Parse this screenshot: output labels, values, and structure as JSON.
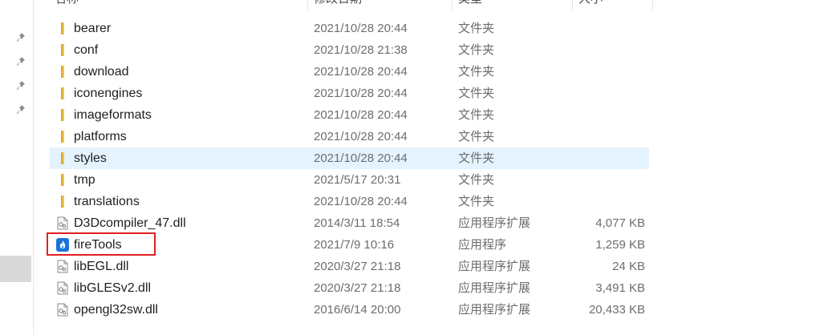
{
  "columns": {
    "name": "名称",
    "date": "修改日期",
    "type": "类型",
    "size": "大小"
  },
  "colors": {
    "folder": "#f5c344",
    "accent": "#e02020",
    "hover": "#e5f3ff"
  },
  "rows": [
    {
      "name": "bearer",
      "date": "2021/10/28 20:44",
      "type": "文件夹",
      "size": "",
      "icon": "folder-icon"
    },
    {
      "name": "conf",
      "date": "2021/10/28 21:38",
      "type": "文件夹",
      "size": "",
      "icon": "folder-icon"
    },
    {
      "name": "download",
      "date": "2021/10/28 20:44",
      "type": "文件夹",
      "size": "",
      "icon": "folder-icon"
    },
    {
      "name": "iconengines",
      "date": "2021/10/28 20:44",
      "type": "文件夹",
      "size": "",
      "icon": "folder-icon"
    },
    {
      "name": "imageformats",
      "date": "2021/10/28 20:44",
      "type": "文件夹",
      "size": "",
      "icon": "folder-icon"
    },
    {
      "name": "platforms",
      "date": "2021/10/28 20:44",
      "type": "文件夹",
      "size": "",
      "icon": "folder-icon"
    },
    {
      "name": "styles",
      "date": "2021/10/28 20:44",
      "type": "文件夹",
      "size": "",
      "icon": "folder-icon"
    },
    {
      "name": "tmp",
      "date": "2021/5/17 20:31",
      "type": "文件夹",
      "size": "",
      "icon": "folder-icon"
    },
    {
      "name": "translations",
      "date": "2021/10/28 20:44",
      "type": "文件夹",
      "size": "",
      "icon": "folder-icon"
    },
    {
      "name": "D3Dcompiler_47.dll",
      "date": "2014/3/11 18:54",
      "type": "应用程序扩展",
      "size": "4,077 KB",
      "icon": "dll-file-icon"
    },
    {
      "name": "fireTools",
      "date": "2021/7/9 10:16",
      "type": "应用程序",
      "size": "1,259 KB",
      "icon": "firetools-app-icon"
    },
    {
      "name": "libEGL.dll",
      "date": "2020/3/27 21:18",
      "type": "应用程序扩展",
      "size": "24 KB",
      "icon": "dll-file-icon"
    },
    {
      "name": "libGLESv2.dll",
      "date": "2020/3/27 21:18",
      "type": "应用程序扩展",
      "size": "3,491 KB",
      "icon": "dll-file-icon"
    },
    {
      "name": "opengl32sw.dll",
      "date": "2016/6/14 20:00",
      "type": "应用程序扩展",
      "size": "20,433 KB",
      "icon": "dll-file-icon"
    }
  ]
}
